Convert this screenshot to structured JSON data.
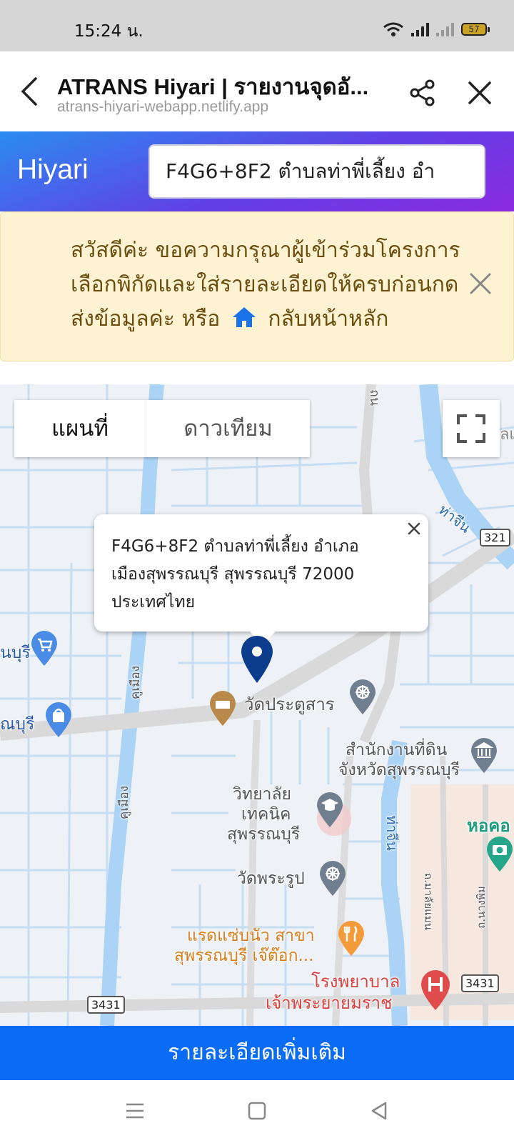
{
  "status_bar": {
    "time": "15:24 น.",
    "battery": "57",
    "icons": [
      "wifi-icon",
      "signal-icon",
      "signal-no-service-icon",
      "battery-icon"
    ]
  },
  "browser": {
    "title": "ATRANS Hiyari | รายงานจุดอั...",
    "url": "atrans-hiyari-webapp.netlify.app",
    "icons": [
      "back-icon",
      "share-icon",
      "close-icon"
    ]
  },
  "app": {
    "brand": "Hiyari",
    "search_value": "F4G6+8F2 ตำบลท่าพี่เลี้ยง อำ"
  },
  "alert": {
    "line1": "สวัสดีค่ะ ขอความกรุณาผู้เข้าร่วมโครงการ",
    "line2": "เลือกพิกัดและใส่รายละเอียดให้ครบก่อนกด",
    "line3_before": "ส่งข้อมูลค่ะ หรือ",
    "line3_link": "กลับหน้าหลัก",
    "colors": {
      "background": "#fdf3d3",
      "text": "#6b4e0f",
      "home_icon": "#1a73e8"
    }
  },
  "map": {
    "type_buttons": [
      "แผนที่",
      "ดาวเทียม"
    ],
    "info_window": {
      "line1": "F4G6+8F2 ตำบลท่าพี่เลี้ยง อำเภอ",
      "line2": "เมืองสุพรรณบุรี สุพรรณบุรี 72000",
      "line3": "ประเทศไทย"
    },
    "labels": {
      "wat_pratu_san": "วัดประตูสาร",
      "land_office_1": "สำนักงานที่ดิน",
      "land_office_2": "จังหวัดสุพรรณบุรี",
      "tech_college_1": "วิทยาลัย",
      "tech_college_2": "เทคนิค",
      "tech_college_3": "สุพรรณบุรี",
      "wat_phra_rup": "วัดพระรูป",
      "restaurant_1": "แรดแซ่บนัว สาขา",
      "restaurant_2": "สุพรรณบุรี เจ๊ต๊อก...",
      "hospital_1": "โรงพยาบาล",
      "hospital_2": "เจ้าพระยายมราช",
      "tower": "หอคอ",
      "khu_mueang_1": "คูเมือง",
      "khu_mueang_2": "คูเมือง",
      "tha_chin_1": "ท่าจีน",
      "tha_chin_2": "ท่าจีน",
      "partial_buri_1": "นบุรี",
      "partial_buri_2": "ณบุรี",
      "partial_top": "ถน",
      "partial_right": "ลเ",
      "street_1": "ถ.มาลัยแมน",
      "street_2": "ถ.นางพิม",
      "route_321": "321",
      "route_3431_a": "3431",
      "route_3431_b": "3431"
    },
    "colors": {
      "water": "#aad3f5",
      "road": "#d9d9d9",
      "hospital": "#e04b4b",
      "poi_gray": "#6f7f8f",
      "poi_food": "#f29b38"
    }
  },
  "details_button": "รายละเอียดเพิ่มเติม",
  "nav": {
    "icons": [
      "menu-icon",
      "home-square-icon",
      "back-triangle-icon"
    ]
  }
}
